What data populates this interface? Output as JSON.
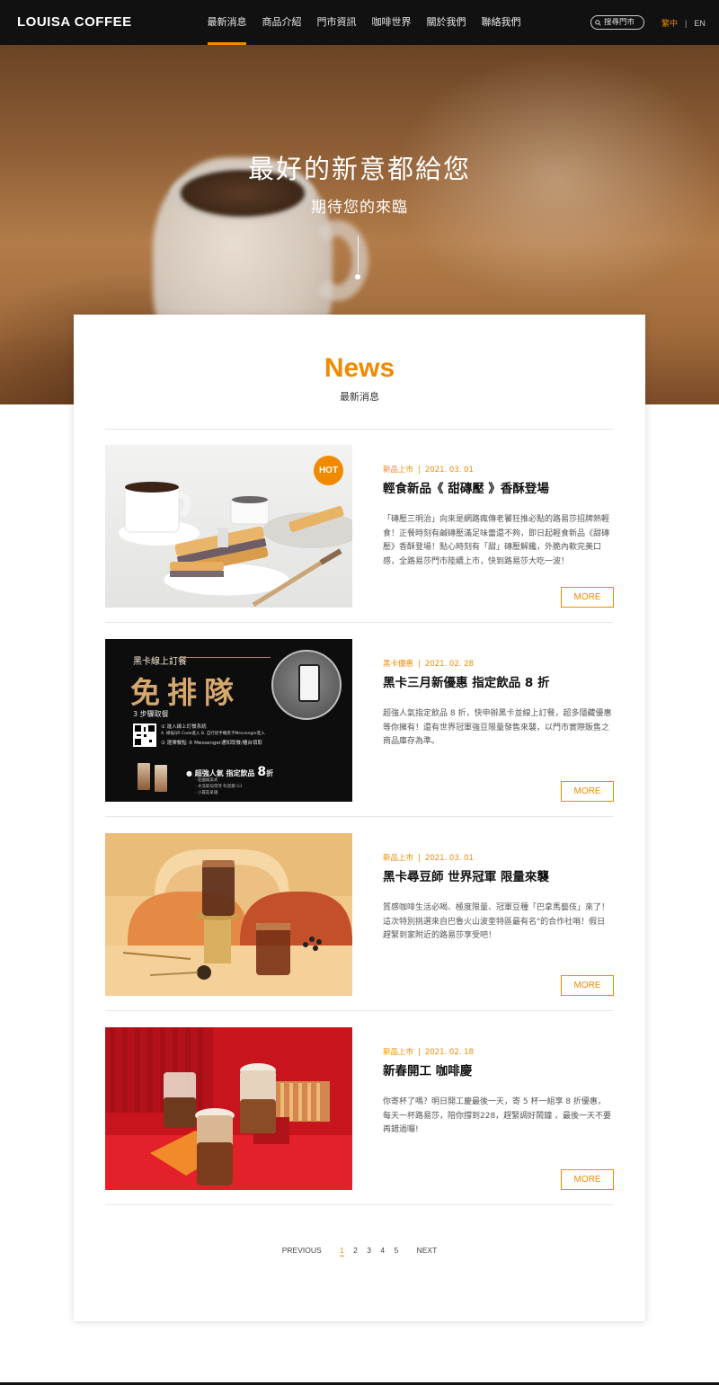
{
  "header": {
    "logo": "LOUISA COFFEE",
    "nav": [
      "最新消息",
      "商品介紹",
      "門市資訊",
      "咖啡世界",
      "關於我們",
      "聯絡我們"
    ],
    "active_nav": "最新消息",
    "search_placeholder": "搜尋門市",
    "lang_zh": "繁中",
    "lang_sep": "|",
    "lang_en": "EN"
  },
  "hero": {
    "title": "最好的新意都給您",
    "subtitle": "期待您的來臨"
  },
  "news": {
    "title": "News",
    "subtitle": "最新消息",
    "items": [
      {
        "category": "新品上市",
        "date": "2021. 03. 01",
        "title": "輕食新品《 甜磚壓 》香酥登場",
        "desc": "「磚壓三明治」向來是網路瘋傳老饕狂推必點的路易莎招牌熱輕食！正餐時刻有鹹磚壓滿足味蕾還不夠，即日起輕食新品《甜磚壓》香酥登場！點心時刻有「甜」磚壓解饞，外脆內軟完美口感，全路易莎門市陸續上市，快到路易莎大吃一波！",
        "badge": "HOT",
        "more": "MORE"
      },
      {
        "category": "黑卡優惠",
        "date": "2021. 02. 28",
        "title": "黑卡三月新優惠 指定飲品 8 折",
        "desc": "超強人氣指定飲品 8 折，快申辦黑卡並線上訂餐，超多隱藏優惠等你擁有！還有世界冠軍強豆限量發售來襲，以門市實際販售之商品庫存為準。",
        "more": "MORE",
        "promo": {
          "top": "黑卡線上訂餐",
          "headline": "免排隊",
          "steps_title": "3 步驟取餐",
          "step1": "① 進入線上訂餐系統",
          "step1a": "A. 掃描QR Code進入  B. 自行從手機黑卡Messenger進入",
          "step2": "② 選擇餐點   ③ Messenger通知取餐/櫃台領取",
          "offer": "● 超強人氣 指定飲品",
          "offer_num": "8",
          "offer_unit": "折",
          "list": "· 莊園級美式\n· 水洗耶加雪菲 科契爾 G1\n· 小農莊拿鐵"
        }
      },
      {
        "category": "新品上市",
        "date": "2021. 03. 01",
        "title": "黑卡尋豆師 世界冠軍 限量來襲",
        "desc": "質感咖啡生活必喝、極度限量、冠軍豆種「巴拿馬藝伎」來了！\n這次特別挑選來自巴魯火山波奎特區最有名\"的合作社哨！假日趕緊到家附近的路易莎享受吧！",
        "more": "MORE"
      },
      {
        "category": "新品上市",
        "date": "2021. 02. 18",
        "title": "新春開工 咖啡慶",
        "desc": "你寄杯了嗎？明日開工慶最後一天，寄 5 杯一組享 8 折優惠，每天一杯路易莎，陪你撐到228，趕緊調好鬧鐘 ，最後一天不要再錯過囉!",
        "more": "MORE"
      }
    ]
  },
  "pagination": {
    "prev": "PREVIOUS",
    "pages": [
      "1",
      "2",
      "3",
      "4",
      "5"
    ],
    "current": "1",
    "next": "NEXT"
  },
  "colors": {
    "accent": "#f08a00",
    "header_bg": "#111111"
  }
}
